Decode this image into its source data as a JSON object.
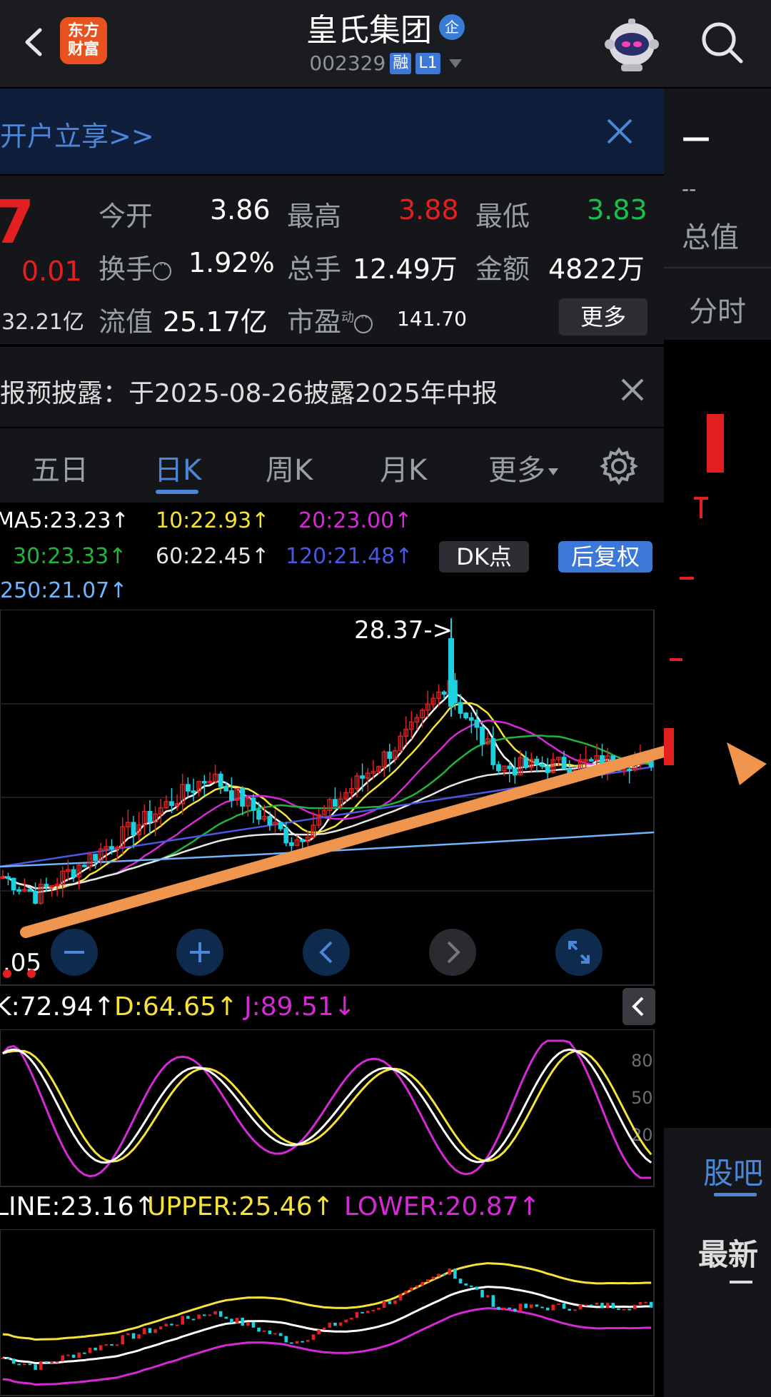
{
  "header": {
    "brand_line1": "东方",
    "brand_line2": "财富",
    "title": "皇氏集团",
    "badge": "企",
    "code": "002329",
    "tag_margin": "融",
    "tag_level": "L1"
  },
  "banner": {
    "text": "开户立享>>"
  },
  "right_column": {
    "price": "—",
    "dash": "--",
    "total_label": "总值",
    "tab_fenshi": "分时",
    "guba_tab": "股吧",
    "latest": "最新"
  },
  "quote": {
    "price_fragment": "7",
    "change": "0.01",
    "market_cap": "32.21亿",
    "open_label": "今开",
    "open_value": "3.86",
    "high_label": "最高",
    "high_value": "3.88",
    "low_label": "最低",
    "low_value": "3.83",
    "turnover_label": "换手",
    "turnover_value": "1.92%",
    "volume_label": "总手",
    "volume_value": "12.49万",
    "amount_label": "金额",
    "amount_value": "4822万",
    "float_label": "流值",
    "float_value": "25.17亿",
    "pe_label": "市盈",
    "pe_sup": "动",
    "pe_value": "141.70",
    "more_button": "更多"
  },
  "notice": {
    "text": "报预披露：于2025-08-26披露2025年中报"
  },
  "tabs": [
    "五日",
    "日K",
    "周K",
    "月K",
    "更多"
  ],
  "active_tab": 1,
  "ma": {
    "ma5": "MA5:23.23↑",
    "ma10": "10:22.93↑",
    "ma20": "20:23.00↑",
    "ma30": "30:23.33↑",
    "ma60": "60:22.45↑",
    "ma120": "120:21.48↑",
    "ma250": "250:21.07↑",
    "dk_button": "DK点",
    "adjust_button": "后复权"
  },
  "main_chart": {
    "high_label": "28.37->",
    "low_label": ".05"
  },
  "kdj": {
    "k": "K:72.94↑",
    "d": "D:64.65↑",
    "j": "J:89.51↓",
    "levels": [
      "80",
      "50",
      "20"
    ]
  },
  "boll": {
    "mid": "LINE:23.16↑",
    "upper": "UPPER:25.46↑",
    "lower": "LOWER:20.87↑"
  },
  "colors": {
    "up": "#e31f1f",
    "down": "#1bd1e0",
    "ma5": "#ffffff",
    "ma10": "#f5e33a",
    "ma20": "#d629d6",
    "ma30": "#21b53a",
    "ma60": "#e6e6e6",
    "ma120": "#4b57e0",
    "ma250": "#6fb4ff",
    "arrow": "#f0954e"
  },
  "icons": [
    "back-icon",
    "search-icon",
    "robot-avatar-icon",
    "close-icon",
    "gear-icon",
    "zoom-out-icon",
    "zoom-in-icon",
    "prev-icon",
    "next-icon",
    "fullscreen-icon",
    "collapse-icon"
  ]
}
